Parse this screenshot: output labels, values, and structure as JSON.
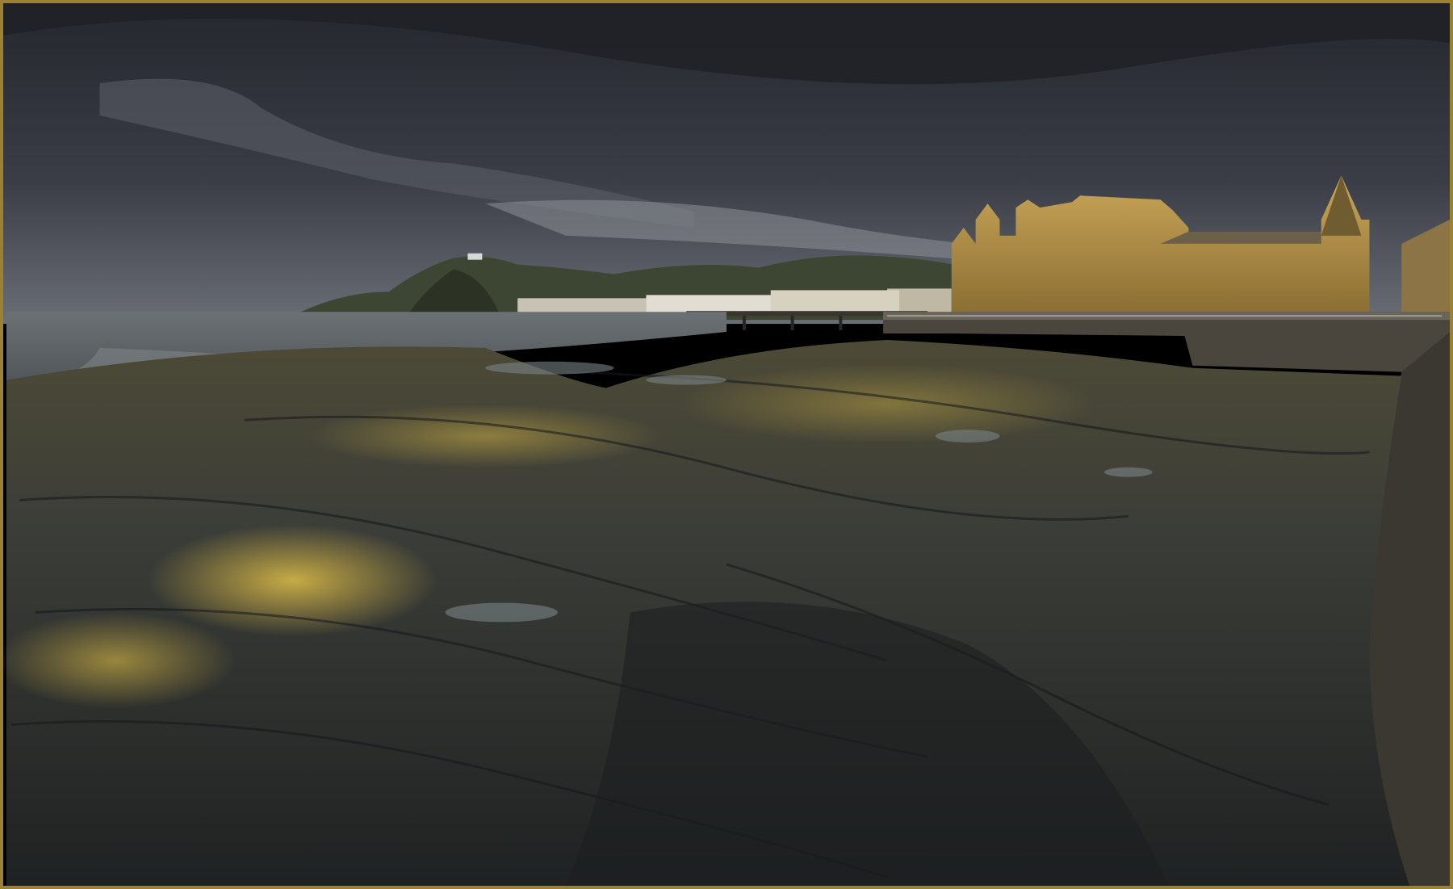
{
  "photo": {
    "scene": "coastal-seafront-low-tide",
    "colors": {
      "frame": "#9a8230",
      "sky_dark": "#2e3038",
      "sky_mid": "#4a4c54",
      "sea": "#6e7478",
      "rock_dark": "#2a2c2c",
      "rock_lit": "#c9a63a",
      "building": "#b8944a",
      "seawall": "#4a463e"
    }
  }
}
